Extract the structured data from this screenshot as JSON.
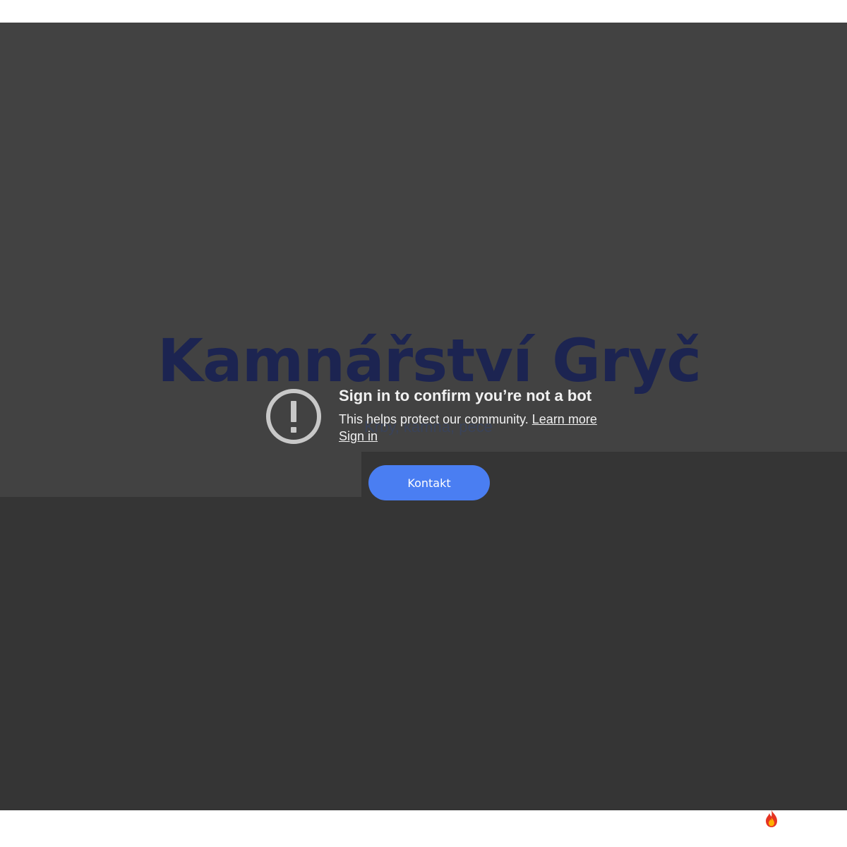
{
  "hero": {
    "title": "Kamnářství Gryč",
    "subtitle": "Krby, kamna, pece"
  },
  "bot_check": {
    "icon": "alert-circle-icon",
    "title": "Sign in to confirm you’re not a bot",
    "message": "This helps protect our community. ",
    "learn_more": "Learn more",
    "sign_in": "Sign in"
  },
  "cta": {
    "label": "Kontakt"
  },
  "widgets": {
    "corner_icon": "fire-icon"
  },
  "colors": {
    "video_overlay": "#424242",
    "page_dark": "#353535",
    "title_color": "#1c2451",
    "button_blue": "#4a7ef2",
    "overlay_text": "#f1f1f1",
    "icon_gray": "#c8c8c8"
  }
}
